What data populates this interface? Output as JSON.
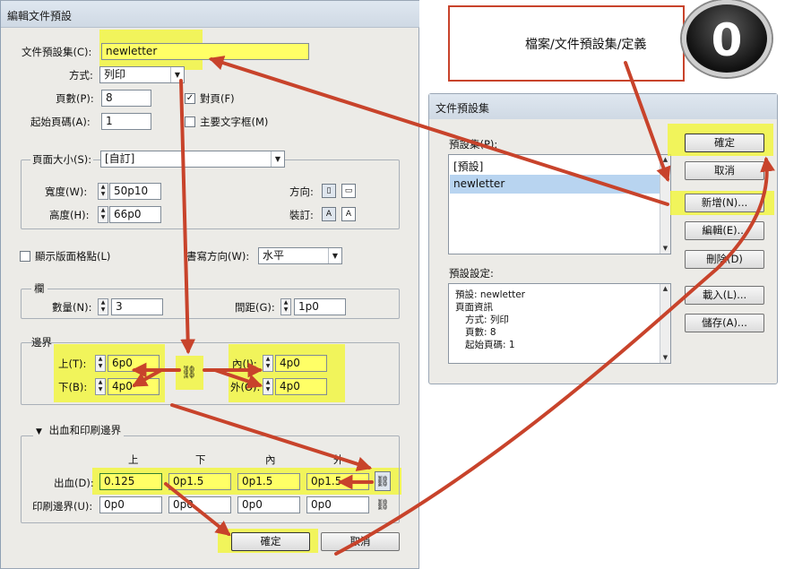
{
  "main_dialog": {
    "title": "編輯文件預設",
    "preset_label": "文件預設集(C):",
    "preset_value": "newletter",
    "intent_label": "方式:",
    "intent_value": "列印",
    "pages_label": "頁數(P):",
    "pages_value": "8",
    "start_label": "起始頁碼(A):",
    "start_value": "1",
    "facing_label": "對頁(F)",
    "facing_checked": "✓",
    "primary_label": "主要文字框(M)",
    "page_size_group": "頁面大小(S):",
    "page_size_value": "[自訂]",
    "width_label": "寬度(W):",
    "width_value": "50p10",
    "height_label": "高度(H):",
    "height_value": "66p0",
    "orientation_label": "方向:",
    "binding_label": "裝訂:",
    "layout_grid_label": "顯示版面格點(L)",
    "writing_dir_label": "書寫方向(W):",
    "writing_dir_value": "水平",
    "columns_group": "欄",
    "number_label": "數量(N):",
    "number_value": "3",
    "gutter_label": "間距(G):",
    "gutter_value": "1p0",
    "margins_group": "邊界",
    "top_label": "上(T):",
    "top_value": "6p0",
    "bottom_label": "下(B):",
    "bottom_value": "4p0",
    "inside_label": "內(I):",
    "inside_value": "4p0",
    "outside_label": "外(O):",
    "outside_value": "4p0",
    "bleed_group": "出血和印刷邊界",
    "col_top": "上",
    "col_bottom": "下",
    "col_inside": "內",
    "col_outside": "外",
    "bleed_label": "出血(D):",
    "bleed_values": [
      "0.125",
      "0p1.5",
      "0p1.5",
      "0p1.5"
    ],
    "slug_label": "印刷邊界(U):",
    "slug_values": [
      "0p0",
      "0p0",
      "0p0",
      "0p0"
    ],
    "ok_label": "確定",
    "cancel_label": "取消"
  },
  "annotation": {
    "path_text": "檔案/文件預設集/定義",
    "step_number": "0"
  },
  "preset_dialog": {
    "title": "文件預設集",
    "presets_label": "預設集(P):",
    "presets": [
      "[預設]",
      "newletter"
    ],
    "selected_preset": "newletter",
    "settings_label": "預設設定:",
    "settings_lines": [
      "預設: newletter",
      "頁面資訊",
      "方式: 列印",
      "頁數: 8",
      "起始頁碼: 1"
    ],
    "ok_label": "確定",
    "cancel_label": "取消",
    "new_label": "新增(N)...",
    "edit_label": "編輯(E)...",
    "delete_label": "刪除(D)",
    "load_label": "載入(L)...",
    "save_label": "儲存(A)..."
  },
  "colors": {
    "highlight": "#f1f53c",
    "arrow": "#c8432b",
    "dialog_bg": "#ecebe7",
    "selection": "#b8d4f0"
  }
}
